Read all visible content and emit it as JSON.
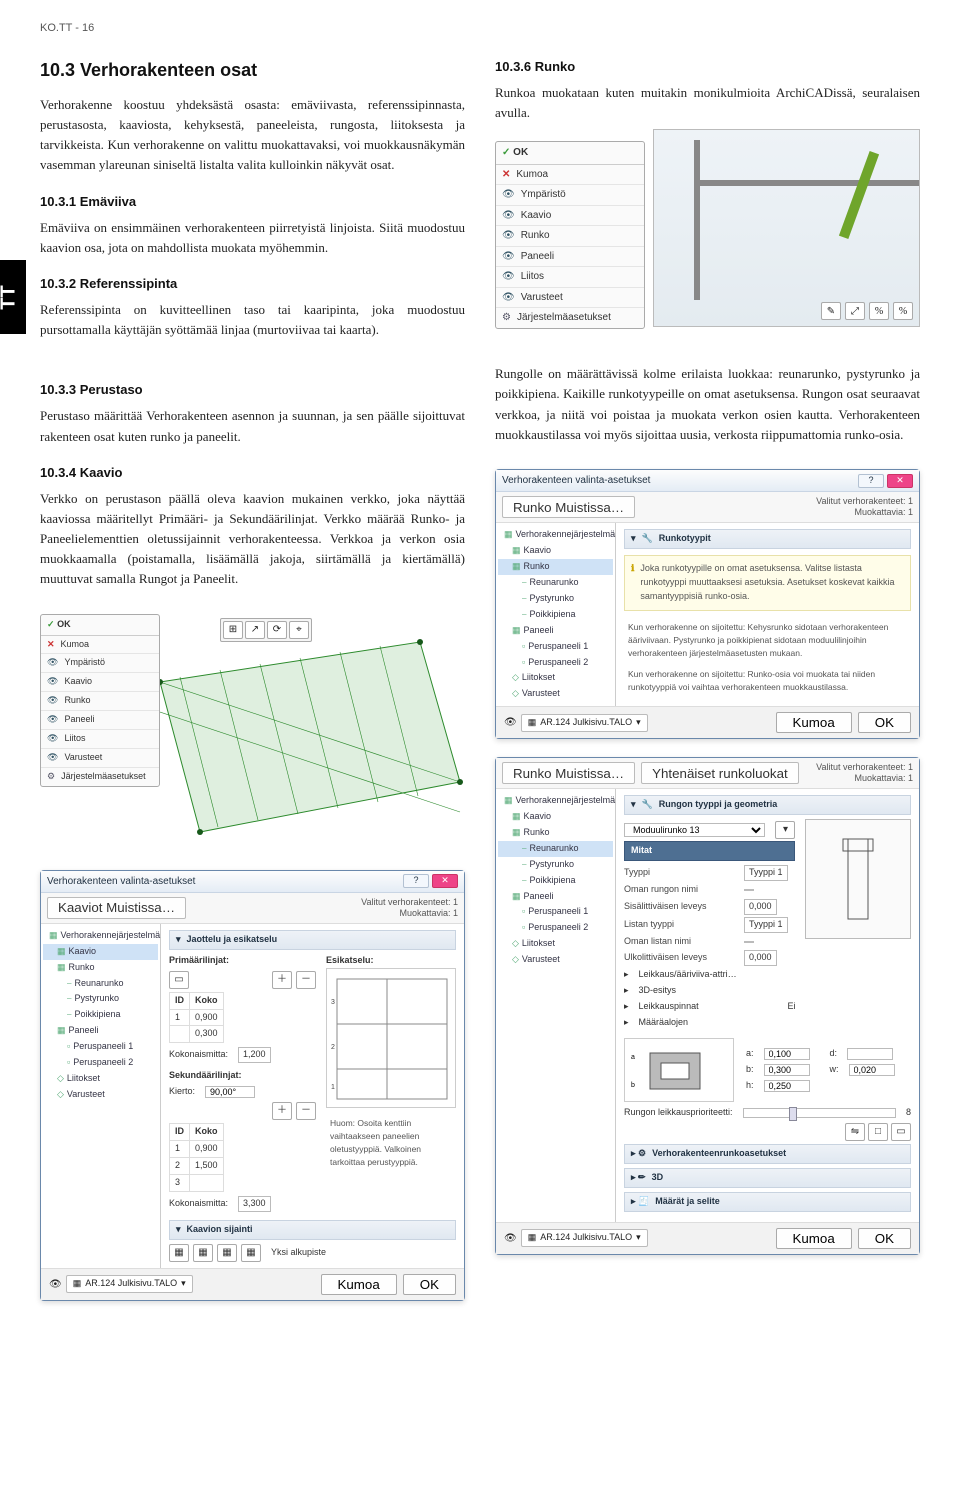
{
  "header": "KO.TT - 16",
  "sidebarTab": "TT",
  "leftCol": {
    "h2": "10.3  Verhorakenteen osat",
    "p1": "Verhorakenne koostuu yhdeksästä osasta: emäviivasta, referenssi­pinnasta, perustasosta, kaaviosta, kehyksestä, paneeleista, rungos­ta, liitoksesta ja tarvikkeista. Kun verhorakenne on valittu muo­kattavaksi, voi muokkausnäkymän vasemman ylareunan siniseltä listalta valita kulloinkin näkyvät osat.",
    "h3a": "10.3.1  Emäviiva",
    "p2": "Emäviiva on ensimmäinen verhorakenteen piirretyistä linjoista. Siitä muodostuu kaavion osa, jota on mahdollista muokata myö­hemmin.",
    "h3b": "10.3.2  Referenssipinta",
    "p3": "Referenssipinta on kuvitteellinen taso tai kaaripinta, joka muo­dostuu pursottamalla käyttäjän syöttämää linjaa (murtoviivaa tai kaarta).",
    "h3c": "10.3.3  Perustaso",
    "p4": "Perustaso määrittää Verhorakenteen asennon ja suunnan, ja sen päälle sijoittuvat rakenteen osat kuten runko ja paneelit.",
    "h3d": "10.3.4  Kaavio",
    "p5": "Verkko on perustason päällä oleva kaavion mukainen verkko, joka näyttää kaaviossa määritellyt Primääri- ja Sekundäärilinjat. Verk­ko määrää Runko- ja Paneelielementtien oletussijainnit verhora­kenteessa. Verkkoa ja verkon osia muokkaamalla (poistamalla, lisäämällä jakoja, siirtämällä ja kiertämällä) muuttuvat samalla Rungot ja Paneelit."
  },
  "rightCol": {
    "h3": "10.3.6  Runko",
    "p1": "Runkoa muokataan kuten muitakin monikulmioita ArchiCADissä, seuralaisen avulla.",
    "p2": "Rungolle on määrättävissä kolme erilaista luokkaa: reuna­runko, pystyrunko ja poikkipiena. Kaikille runkotyypeille on omat asetuksensa. Rungon osat seuraavat verkkoa, ja niitä voi poistaa ja muokata verkon osien kautta. Verhorakenteen muokkaustilassa voi myös sijoittaa uusia, verkosta riippumattomia runko-osia."
  },
  "popup": {
    "ok": "OK",
    "kumoa": "Kumoa",
    "ymparisto": "Ympäristö",
    "items": [
      "Kaavio",
      "Runko",
      "Paneeli",
      "Liitos",
      "Varusteet"
    ],
    "footer": "Järjestelmäasetukset"
  },
  "popupSmall": {
    "ok": "OK",
    "kumoa": "Kumoa",
    "ymparisto": "Ympäristö",
    "items": [
      "Kaavio",
      "Runko",
      "Paneeli",
      "Liitos",
      "Varusteet"
    ],
    "footer": "Järjestelmäasetukset"
  },
  "dlgKaavio": {
    "title": "Verhorakenteen valinta-asetukset",
    "toolbarBtn": "Kaaviot Muistissa…",
    "metaA": "Valitut verhorakenteet: 1",
    "metaB": "Muokattavia: 1",
    "tree": [
      "Verhorakennejärjestelmä",
      "Kaavio",
      "Runko",
      "Reunarunko",
      "Pystyrunko",
      "Poikkipiena",
      "Paneeli",
      "Peruspaneeli 1",
      "Peruspaneeli 2",
      "Liitokset",
      "Varusteet"
    ],
    "sectionA": "Jaottelu ja esikatselu",
    "primLabel": "Primäärilinjat:",
    "preview": "Esikatselu:",
    "thID": "ID",
    "thKoko": "Koko",
    "rows": [
      [
        "1",
        "0,900"
      ],
      [
        "",
        "0,300"
      ]
    ],
    "kokonaismittaA": "Kokonaismitta:",
    "kokVA": "1,200",
    "sekLabel": "Sekundäärilinjat:",
    "kierto": "Kierto:",
    "kiertoVal": "90,00°",
    "rowsB": [
      [
        "1",
        "0,900"
      ],
      [
        "2",
        "1,500"
      ],
      [
        "3",
        ""
      ]
    ],
    "kokonaismittaB": "Kokonaismitta:",
    "kokVB": "3,300",
    "note": "Huom: Osoita kenttiin vaihtaakseen paneelien oletustyyppiä. Valkoinen tarkoittaa perustyyppiä.",
    "sectionB": "Kaavion sijainti",
    "alku": "Yksi alkupiste",
    "layer": "AR.124 Julkisivu.TALO",
    "cancel": "Kumoa",
    "okBtn": "OK"
  },
  "dlgRunkotyypit": {
    "title": "Verhorakenteen valinta-asetukset",
    "toolbarBtn": "Runko Muistissa…",
    "metaA": "Valitut verhorakenteet: 1",
    "metaB": "Muokattavia: 1",
    "tree": [
      "Verhorakennejärjestelmä",
      "Kaavio",
      "Runko",
      "Reunarunko",
      "Pystyrunko",
      "Poikkipiena",
      "Paneeli",
      "Peruspaneeli 1",
      "Peruspaneeli 2",
      "Liitokset",
      "Varusteet"
    ],
    "section": "Runkotyypit",
    "info1": "Joka runkotyypille on omat asetuksensa. Valitse listasta runkotyyppi muuttaaksesi asetuksia. Asetukset koskevat kaikkia samantyyppisiä runko-osia.",
    "info2": "Kun verhorakenne on sijoitettu: Kehysrunko sidotaan verhorakenteen ääriviivaan. Pystyrunko ja poikkipienat sidotaan moduulilinjoihin verhorakenteen järjestelmäasetusten mukaan.",
    "info3": "Kun verhorakenne on sijoitettu: Runko-osia voi muokata tai niiden runkotyyppiä voi vaihtaa verhorakenteen muokkaustilassa.",
    "layer": "AR.124 Julkisivu.TALO",
    "cancel": "Kumoa",
    "ok": "OK"
  },
  "dlgRungonTyyppi": {
    "toolbarBtnA": "Runko Muistissa…",
    "toolbarBtnB": "Yhtenäiset runkoluokat",
    "metaA": "Valitut verhorakenteet: 1",
    "metaB": "Muokattavia: 1",
    "tree": [
      "Verhorakennejärjestelmä",
      "Kaavio",
      "Runko",
      "Reunarunko",
      "Pystyrunko",
      "Poikkipiena",
      "Paneeli",
      "Peruspaneeli 1",
      "Peruspaneeli 2",
      "Liitokset",
      "Varusteet"
    ],
    "section": "Rungon tyyppi ja geometria",
    "selectLabel": "Moduulirunko 13",
    "groupMitat": "Mitat",
    "fields": [
      [
        "Tyyppi",
        "Tyyppi 1"
      ],
      [
        "Oman rungon nimi",
        ""
      ],
      [
        "Sisälittiväisen leveys",
        "0,000"
      ],
      [
        "Listan tyyppi",
        "Tyyppi 1"
      ],
      [
        "Oman listan nimi",
        ""
      ],
      [
        "Ulkolittiväisen leveys",
        "0,000"
      ]
    ],
    "collapse": [
      "Leikkaus/ääriviiva-attri…",
      "3D-esitys",
      "Leikkauspinnat",
      "Määräalojen"
    ],
    "leikkausVal": "Ei",
    "dims": [
      [
        "a:",
        "0,100"
      ],
      [
        "d:",
        ""
      ],
      [
        "b:",
        "0,300"
      ],
      [
        "w:",
        "0,020"
      ],
      [
        "h:",
        "0,250"
      ]
    ],
    "rungonLeik": "Rungon leikkausprioriteetti:",
    "collapse2": [
      "Verhorakenteenrunkoasetukset",
      "3D",
      "Määrät ja selite"
    ],
    "layer": "AR.124 Julkisivu.TALO",
    "cancel": "Kumoa",
    "ok": "OK"
  }
}
